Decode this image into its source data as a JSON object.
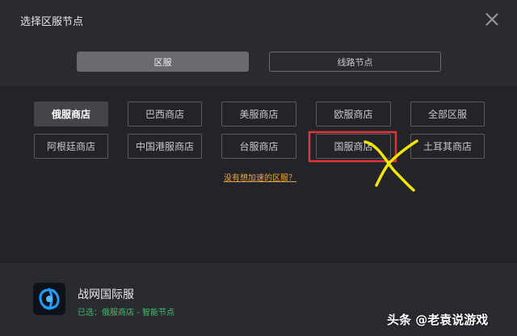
{
  "window": {
    "title": "选择区服节点"
  },
  "mode_tabs": [
    {
      "label": "区服",
      "active": true
    },
    {
      "label": "线路节点",
      "active": false
    }
  ],
  "shops": [
    {
      "label": "俄服商店",
      "selected": true
    },
    {
      "label": "巴西商店",
      "selected": false
    },
    {
      "label": "美服商店",
      "selected": false
    },
    {
      "label": "欧服商店",
      "selected": false
    },
    {
      "label": "全部区服",
      "selected": false
    },
    {
      "label": "阿根廷商店",
      "selected": false
    },
    {
      "label": "中国港服商店",
      "selected": false
    },
    {
      "label": "台服商店",
      "selected": false
    },
    {
      "label": "国服商店",
      "selected": false
    },
    {
      "label": "土耳其商店",
      "selected": false
    }
  ],
  "missing_link": "没有想加速的区服？",
  "footer": {
    "game_name": "战网国际服",
    "status": "已选：俄服商店 - 智能节点"
  },
  "watermark": "头条 @老袁说游戏",
  "colors": {
    "highlight_box": "#e0343a",
    "annotation_x": "#f2e600",
    "status_green": "#3fbf6a",
    "link_orange": "#e9a53a"
  }
}
